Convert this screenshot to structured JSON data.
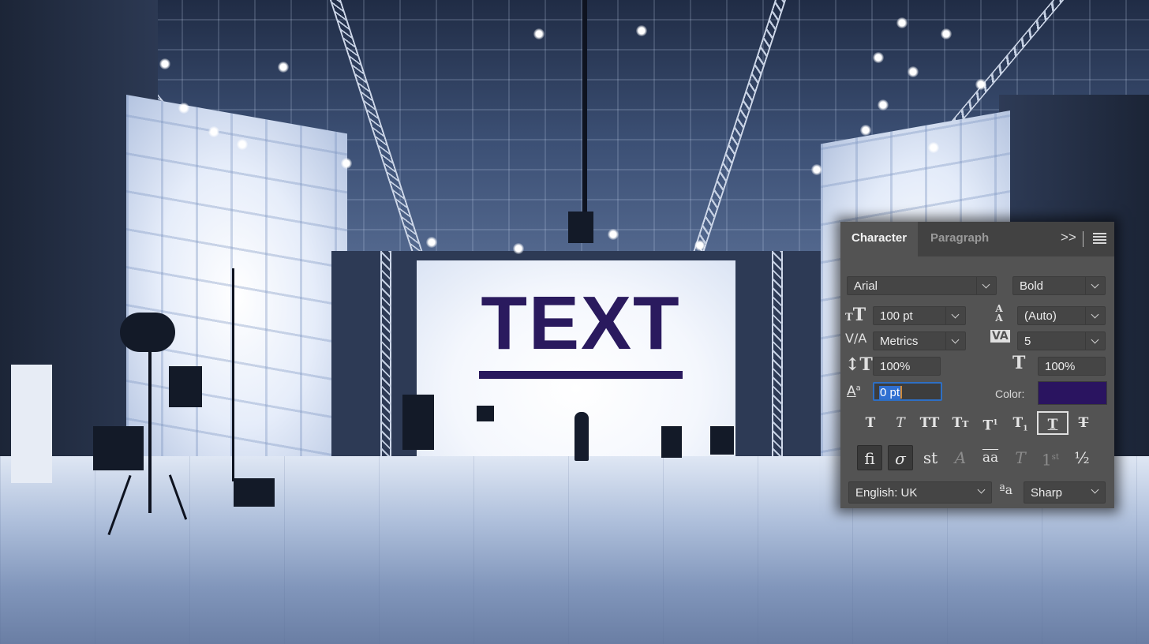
{
  "canvas": {
    "text": "TEXT",
    "text_color": "#2a1a5e"
  },
  "panel": {
    "tabs": [
      {
        "label": "Character",
        "active": true
      },
      {
        "label": "Paragraph",
        "active": false
      }
    ],
    "collapse_glyph": ">>",
    "font_family": "Arial",
    "font_style": "Bold",
    "font_size": "100 pt",
    "leading": "(Auto)",
    "kerning": "Metrics",
    "tracking": "5",
    "vertical_scale": "100%",
    "horizontal_scale": "100%",
    "baseline_shift": "0 pt",
    "color_label": "Color:",
    "color_value": "#2a1460",
    "style_buttons": [
      {
        "name": "faux-bold",
        "glyph": "T"
      },
      {
        "name": "faux-italic",
        "glyph": "T"
      },
      {
        "name": "all-caps",
        "glyph": "TT"
      },
      {
        "name": "small-caps",
        "glyph": "Tт"
      },
      {
        "name": "superscript",
        "glyph": "T¹"
      },
      {
        "name": "subscript",
        "glyph": "T₁"
      },
      {
        "name": "underline",
        "glyph": "T",
        "selected": true
      },
      {
        "name": "strikethrough",
        "glyph": "T"
      }
    ],
    "opentype_buttons": [
      {
        "name": "standard-ligatures",
        "glyph": "fi",
        "pressed": true
      },
      {
        "name": "contextual-alternates",
        "glyph": "ℴ",
        "pressed": true
      },
      {
        "name": "discretionary-ligatures",
        "glyph": "st"
      },
      {
        "name": "swash",
        "glyph": "𝒜",
        "disabled": true
      },
      {
        "name": "stylistic-alternates",
        "glyph": "aa"
      },
      {
        "name": "titling-alternates",
        "glyph": "𝕋",
        "disabled": true
      },
      {
        "name": "ordinals",
        "glyph": "1ˢᵗ",
        "disabled": true
      },
      {
        "name": "fractions",
        "glyph": "½"
      }
    ],
    "language": "English: UK",
    "antialias_glyph": "ªa",
    "antialias": "Sharp"
  }
}
